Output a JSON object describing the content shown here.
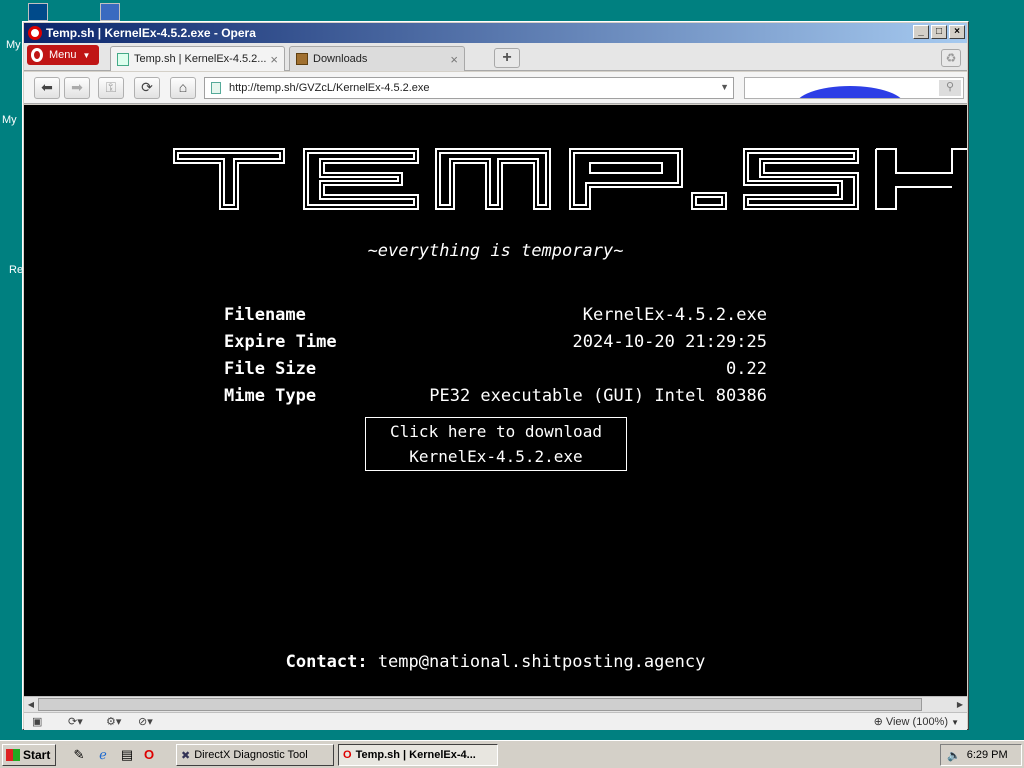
{
  "desktop": {
    "labels": [
      "My",
      "My",
      "Re"
    ]
  },
  "window": {
    "title": "Temp.sh | KernelEx-4.5.2.exe - Opera",
    "menu_label": "Menu",
    "tabs": [
      {
        "label": "Temp.sh | KernelEx-4.5.2...",
        "active": true
      },
      {
        "label": "Downloads",
        "active": false
      }
    ],
    "new_tab": "+",
    "address": "http://temp.sh/GVZcL/KernelEx-4.5.2.exe",
    "zoom_label": "View (100%)"
  },
  "page": {
    "logo_text": "TEMP.SH",
    "tagline": "~everything is temporary~",
    "info": [
      {
        "key": "Filename",
        "value": "KernelEx-4.5.2.exe"
      },
      {
        "key": "Expire Time",
        "value": "2024-10-20 21:29:25"
      },
      {
        "key": "File Size",
        "value": "0.22"
      },
      {
        "key": "Mime Type",
        "value": "PE32 executable (GUI) Intel 80386"
      }
    ],
    "download_line1": "Click here to download",
    "download_line2": "KernelEx-4.5.2.exe",
    "contact_label": "Contact:",
    "contact_email": "temp@national.shitposting.agency"
  },
  "taskbar": {
    "start_label": "Start",
    "tasks": [
      {
        "label": "DirectX Diagnostic Tool",
        "active": false
      },
      {
        "label": "Temp.sh | KernelEx-4...",
        "active": true
      }
    ],
    "clock": "6:29 PM"
  },
  "colors": {
    "desktop": "#008080",
    "titlebar_start": "#0a246a",
    "opera_red": "#c01515",
    "page_bg": "#000000",
    "page_text": "#ffffff"
  }
}
